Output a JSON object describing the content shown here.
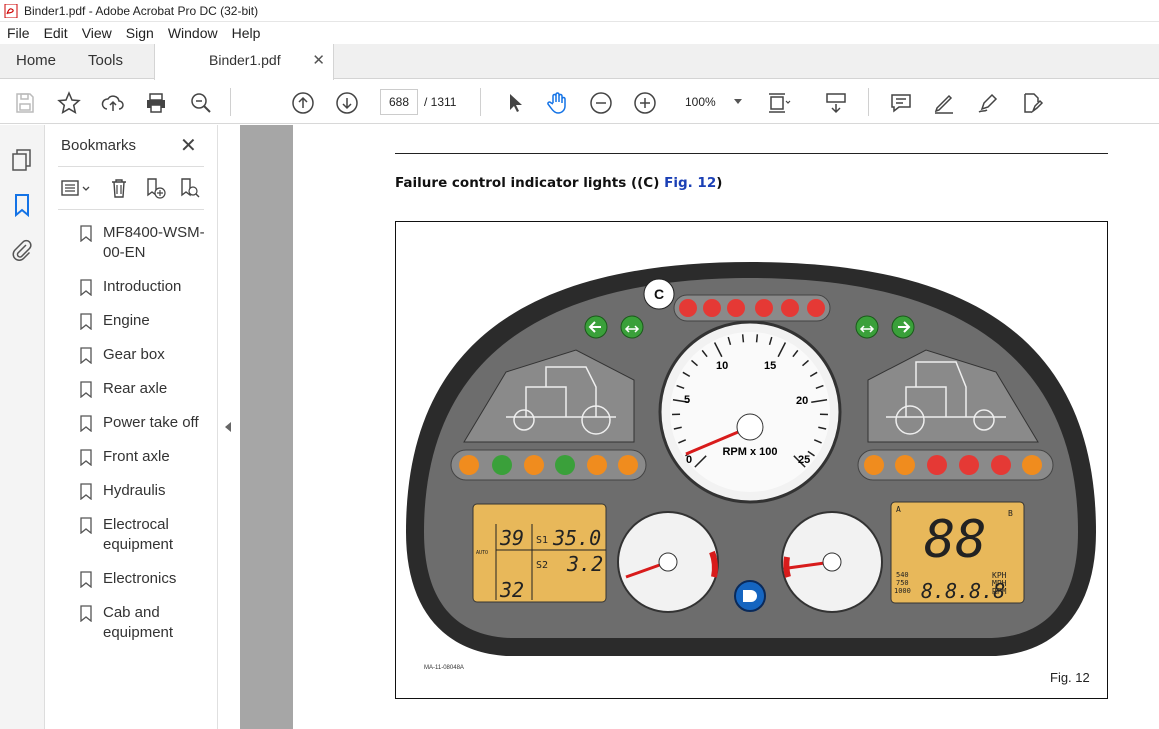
{
  "window": {
    "title": "Binder1.pdf - Adobe Acrobat Pro DC (32-bit)"
  },
  "menu": [
    "File",
    "Edit",
    "View",
    "Sign",
    "Window",
    "Help"
  ],
  "tabs": {
    "home": "Home",
    "tools": "Tools",
    "document": "Binder1.pdf"
  },
  "toolbar": {
    "page_current": "688",
    "page_total": "/ 1311",
    "zoom": "100%"
  },
  "bookmarks": {
    "title": "Bookmarks",
    "items": [
      "MF8400-WSM-00-EN",
      "Introduction",
      "Engine",
      "Gear box",
      "Rear axle",
      "Power take off",
      "Front axle",
      "Hydraulis",
      "Electrocal equipment",
      "Electronics",
      "Cab and equipment"
    ]
  },
  "document": {
    "heading_text": "Failure control indicator lights ((C) ",
    "heading_link": "Fig. 12",
    "heading_end": ")",
    "figure_caption": "Fig. 12",
    "figure_code": "MA-11-08048A",
    "cluster": {
      "callout": "C",
      "rpm_label": "RPM x 100",
      "rpm_ticks": [
        "0",
        "5",
        "10",
        "15",
        "20",
        "25"
      ],
      "rpm_value": 0.5,
      "left_lcd": {
        "top_left": "39",
        "s1_label": "S1",
        "s1_value": "35.0",
        "s2_label": "S2",
        "s2_value": "3.2",
        "bottom": "32",
        "auto": "AUTO"
      },
      "right_lcd": {
        "big": "88",
        "digits": "8.8.8.8",
        "kph": "KPH",
        "mph": "MPH",
        "rpm": "RPM",
        "pto1": "540",
        "pto2": "750",
        "pto3": "1000",
        "a": "A",
        "b": "B"
      }
    }
  },
  "colors": {
    "accent_link": "#1a3fb5",
    "lcd": "#e8b85a",
    "bezel": "#2b2b2b",
    "face": "#6d6d6d"
  }
}
